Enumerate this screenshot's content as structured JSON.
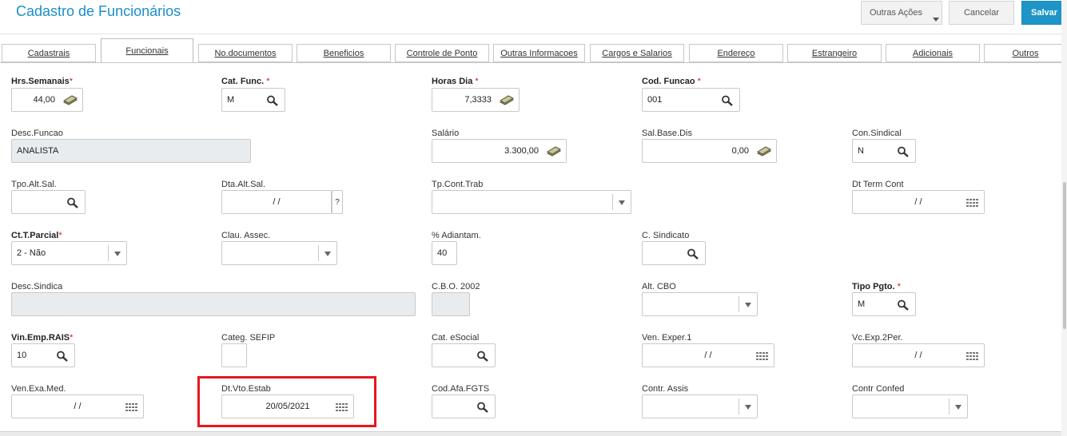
{
  "header": {
    "title": "Cadastro de Funcionários",
    "more_actions": "Outras Ações",
    "cancel": "Cancelar",
    "save": "Salvar"
  },
  "tabs": [
    "Cadastrais",
    "Funcionais",
    "No.documentos",
    "Beneficios",
    "Controle de Ponto",
    "Outras Informacoes",
    "Cargos e Salarios",
    "Endereço",
    "Estrangeiro",
    "Adicionais",
    "Outros"
  ],
  "active_tab": "Funcionais",
  "fields": {
    "hrs_semanais": {
      "label": "Hrs.Semanais",
      "value": "44,00"
    },
    "cat_func": {
      "label": "Cat. Func.",
      "value": "M"
    },
    "horas_dia": {
      "label": "Horas Dia",
      "value": "7,3333"
    },
    "cod_funcao": {
      "label": "Cod. Funcao",
      "value": "001"
    },
    "desc_funcao": {
      "label": "Desc.Funcao",
      "value": "ANALISTA"
    },
    "salario": {
      "label": "Salário",
      "value": "3.300,00"
    },
    "sal_base_dis": {
      "label": "Sal.Base.Dis",
      "value": "0,00"
    },
    "con_sindical": {
      "label": "Con.Sindical",
      "value": "N"
    },
    "tpo_alt_sal": {
      "label": "Tpo.Alt.Sal.",
      "value": ""
    },
    "dta_alt_sal": {
      "label": "Dta.Alt.Sal.",
      "value": "/ /",
      "help": "?"
    },
    "tp_cont_trab": {
      "label": "Tp.Cont.Trab",
      "value": ""
    },
    "dt_term_cont": {
      "label": "Dt Term Cont",
      "value": "/ /"
    },
    "ct_t_parcial": {
      "label": "Ct.T.Parcial",
      "value": "2 - Não"
    },
    "clau_assec": {
      "label": "Clau. Assec.",
      "value": ""
    },
    "pct_adiantam": {
      "label": "% Adiantam.",
      "value": "40"
    },
    "c_sindicato": {
      "label": "C. Sindicato",
      "value": ""
    },
    "desc_sindica": {
      "label": "Desc.Sindica",
      "value": ""
    },
    "cbo_2002": {
      "label": "C.B.O. 2002",
      "value": ""
    },
    "alt_cbo": {
      "label": "Alt. CBO",
      "value": ""
    },
    "tipo_pgto": {
      "label": "Tipo Pgto.",
      "value": "M"
    },
    "vin_emp_rais": {
      "label": "Vin.Emp.RAIS",
      "value": "10"
    },
    "categ_sefip": {
      "label": "Categ. SEFIP",
      "value": ""
    },
    "cat_esocial": {
      "label": "Cat. eSocial",
      "value": ""
    },
    "ven_exper_1": {
      "label": "Ven. Exper.1",
      "value": "/ /"
    },
    "vc_exp_2per": {
      "label": "Vc.Exp.2Per.",
      "value": "/ /"
    },
    "ven_exa_med": {
      "label": "Ven.Exa.Med.",
      "value": "/ /"
    },
    "dt_vto_estab": {
      "label": "Dt.Vto.Estab",
      "value": "20/05/2021"
    },
    "cod_afa_fgts": {
      "label": "Cod.Afa.FGTS",
      "value": ""
    },
    "contr_assis": {
      "label": "Contr. Assis",
      "value": ""
    },
    "contr_confed": {
      "label": "Contr Confed",
      "value": ""
    }
  },
  "required_mark": "*",
  "colors": {
    "accent": "#1e95c7",
    "title": "#1a8fc9",
    "required": "#dd1111",
    "highlight": "#e8161e"
  }
}
